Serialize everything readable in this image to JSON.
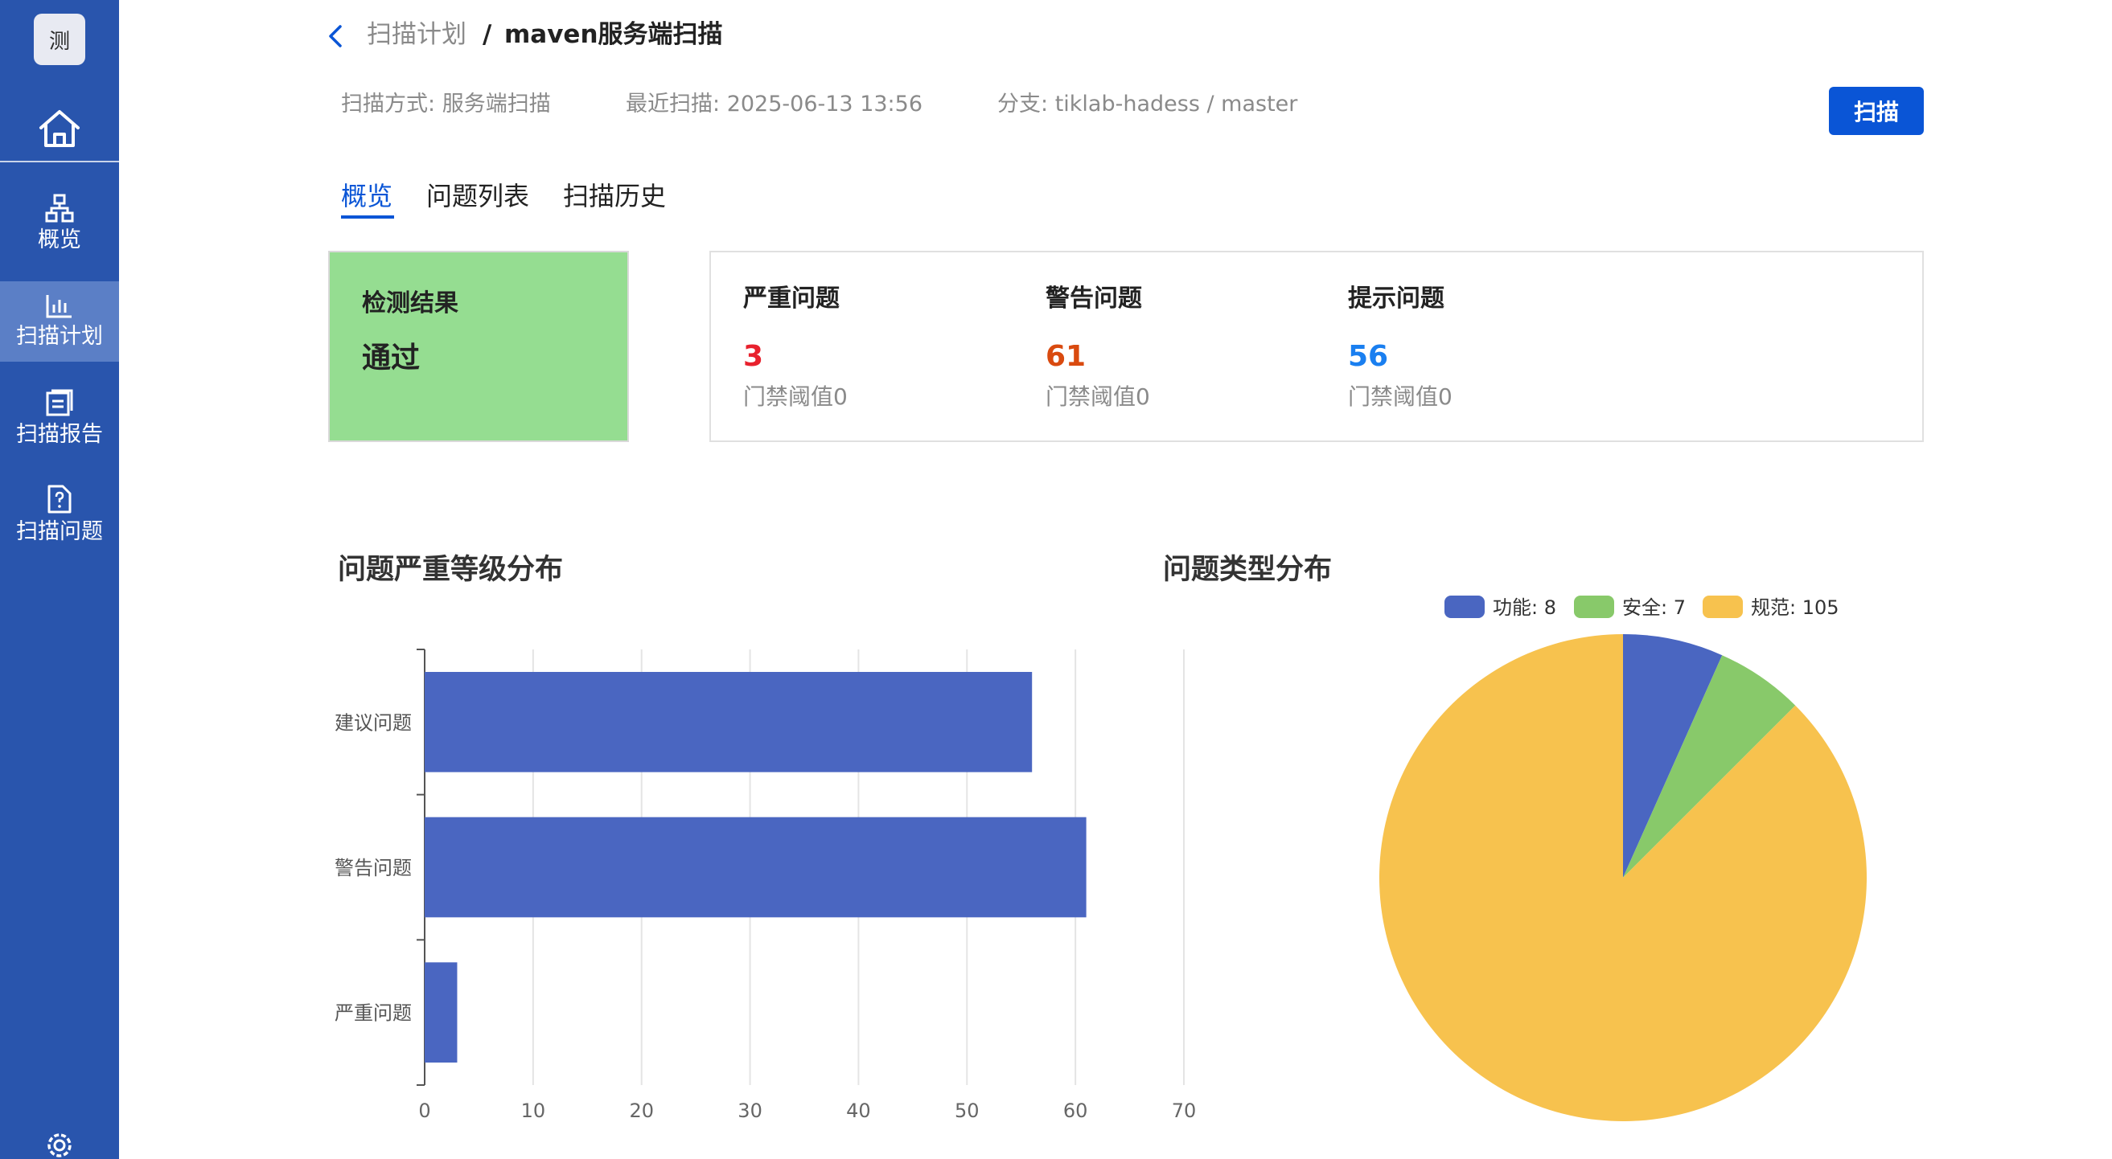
{
  "app": {
    "logo_text": "测"
  },
  "sidebar": {
    "items": [
      {
        "label": "概览",
        "icon": "sitemap-icon"
      },
      {
        "label": "扫描计划",
        "icon": "bar-chart-icon"
      },
      {
        "label": "扫描报告",
        "icon": "report-icon"
      },
      {
        "label": "扫描问题",
        "icon": "question-file-icon"
      }
    ],
    "active_index": 1
  },
  "header": {
    "breadcrumb_parent": "扫描计划",
    "breadcrumb_separator": "/",
    "title": "maven服务端扫描",
    "scan_mode_label": "扫描方式:",
    "scan_mode_value": "服务端扫描",
    "last_scan_label": "最近扫描:",
    "last_scan_value": "2025-06-13 13:56",
    "branch_label": "分支:",
    "branch_value": "tiklab-hadess / master",
    "scan_button": "扫描"
  },
  "tabs": [
    {
      "label": "概览",
      "active": true
    },
    {
      "label": "问题列表",
      "active": false
    },
    {
      "label": "扫描历史",
      "active": false
    }
  ],
  "result": {
    "title": "检测结果",
    "value": "通过",
    "color": "#95dd91"
  },
  "metrics": [
    {
      "title": "严重问题",
      "value": "3",
      "threshold": "门禁阈值0",
      "color": "#e8212d"
    },
    {
      "title": "警告问题",
      "value": "61",
      "threshold": "门禁阈值0",
      "color": "#d94a0f"
    },
    {
      "title": "提示问题",
      "value": "56",
      "threshold": "门禁阈值0",
      "color": "#1a7ff0"
    }
  ],
  "charts": {
    "severity_title": "问题严重等级分布",
    "type_title": "问题类型分布"
  },
  "chart_data": [
    {
      "type": "bar",
      "orientation": "horizontal",
      "title": "问题严重等级分布",
      "categories": [
        "建议问题",
        "警告问题",
        "严重问题"
      ],
      "values": [
        56,
        61,
        3
      ],
      "xlim": [
        0,
        70
      ],
      "xticks": [
        0,
        10,
        20,
        30,
        40,
        50,
        60,
        70
      ],
      "grid": true,
      "color": "#4a66c1"
    },
    {
      "type": "pie",
      "title": "问题类型分布",
      "labels": [
        "功能",
        "安全",
        "规范"
      ],
      "values": [
        8,
        7,
        105
      ],
      "colors": [
        "#4a66c1",
        "#88c96a",
        "#f7c24e"
      ],
      "legend": "top"
    }
  ]
}
